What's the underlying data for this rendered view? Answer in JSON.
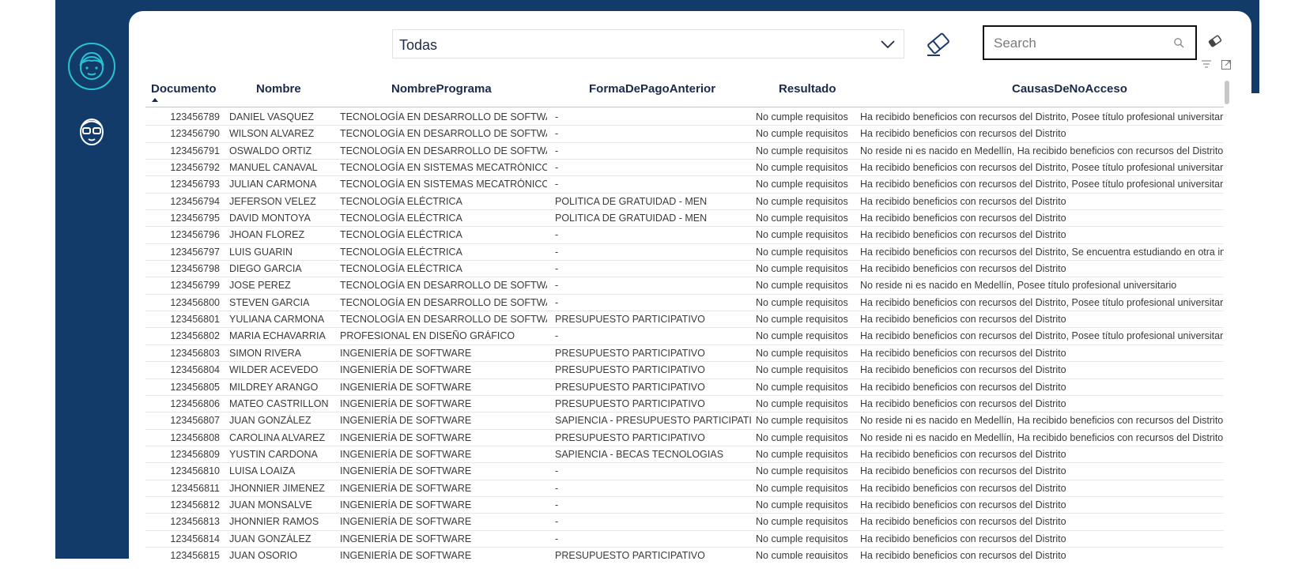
{
  "filters": {
    "dropdown_value": "Todas",
    "search_placeholder": "Search"
  },
  "table": {
    "headers": {
      "documento": "Documento",
      "nombre": "Nombre",
      "programa": "NombrePrograma",
      "pago": "FormaDePagoAnterior",
      "resultado": "Resultado",
      "causas": "CausasDeNoAcceso"
    },
    "sort": {
      "column": "Documento",
      "direction": "ascending"
    },
    "rows": [
      {
        "doc": "123456789",
        "name": "DANIEL VASQUEZ",
        "prog": "TECNOLOGÍA EN DESARROLLO DE SOFTWARE",
        "pago": "-",
        "res": "No cumple requisitos",
        "causa": "Ha recibido beneficios con recursos del Distrito, Posee título profesional universitario"
      },
      {
        "doc": "123456790",
        "name": "WILSON ALVAREZ",
        "prog": "TECNOLOGÍA EN DESARROLLO DE SOFTWARE",
        "pago": "-",
        "res": "No cumple requisitos",
        "causa": "Ha recibido beneficios con recursos del Distrito"
      },
      {
        "doc": "123456791",
        "name": "OSWALDO ORTIZ",
        "prog": "TECNOLOGÍA EN DESARROLLO DE SOFTWARE",
        "pago": "-",
        "res": "No cumple requisitos",
        "causa": "No reside ni es nacido en Medellín, Ha recibido beneficios con recursos del Distrito"
      },
      {
        "doc": "123456792",
        "name": "MANUEL CANAVAL",
        "prog": "TECNOLOGÍA EN SISTEMAS MECATRÓNICOS",
        "pago": "-",
        "res": "No cumple requisitos",
        "causa": "Ha recibido beneficios con recursos del Distrito, Posee título profesional universitario"
      },
      {
        "doc": "123456793",
        "name": "JULIAN CARMONA",
        "prog": "TECNOLOGÍA EN SISTEMAS MECATRÓNICOS",
        "pago": "-",
        "res": "No cumple requisitos",
        "causa": "Ha recibido beneficios con recursos del Distrito, Posee título profesional universitario"
      },
      {
        "doc": "123456794",
        "name": "JEFERSON VELEZ",
        "prog": "TECNOLOGÍA ELÉCTRICA",
        "pago": "POLITICA DE GRATUIDAD - MEN",
        "res": "No cumple requisitos",
        "causa": "Ha recibido beneficios con recursos del Distrito"
      },
      {
        "doc": "123456795",
        "name": "DAVID MONTOYA",
        "prog": "TECNOLOGÍA ELÉCTRICA",
        "pago": "POLITICA DE GRATUIDAD - MEN",
        "res": "No cumple requisitos",
        "causa": "Ha recibido beneficios con recursos del Distrito"
      },
      {
        "doc": "123456796",
        "name": "JHOAN FLOREZ",
        "prog": "TECNOLOGÍA ELÉCTRICA",
        "pago": "-",
        "res": "No cumple requisitos",
        "causa": "Ha recibido beneficios con recursos del Distrito"
      },
      {
        "doc": "123456797",
        "name": "LUIS GUARIN",
        "prog": "TECNOLOGÍA ELÉCTRICA",
        "pago": "-",
        "res": "No cumple requisitos",
        "causa": "Ha recibido beneficios con recursos del Distrito, Se encuentra estudiando en otra institución"
      },
      {
        "doc": "123456798",
        "name": "DIEGO GARCIA",
        "prog": "TECNOLOGÍA ELÉCTRICA",
        "pago": "-",
        "res": "No cumple requisitos",
        "causa": "Ha recibido beneficios con recursos del Distrito"
      },
      {
        "doc": "123456799",
        "name": "JOSE PEREZ",
        "prog": "TECNOLOGÍA EN DESARROLLO DE SOFTWARE",
        "pago": "-",
        "res": "No cumple requisitos",
        "causa": "No reside ni es nacido en Medellín, Posee título profesional universitario"
      },
      {
        "doc": "123456800",
        "name": "STEVEN GARCIA",
        "prog": "TECNOLOGÍA EN DESARROLLO DE SOFTWARE",
        "pago": "-",
        "res": "No cumple requisitos",
        "causa": "Ha recibido beneficios con recursos del Distrito, Posee título profesional universitario"
      },
      {
        "doc": "123456801",
        "name": "YULIANA CARMONA",
        "prog": "TECNOLOGÍA EN DESARROLLO DE SOFTWARE",
        "pago": "PRESUPUESTO PARTICIPATIVO",
        "res": "No cumple requisitos",
        "causa": "Ha recibido beneficios con recursos del Distrito"
      },
      {
        "doc": "123456802",
        "name": "MARIA ECHAVARRIA",
        "prog": "PROFESIONAL EN DISEÑO GRÁFICO",
        "pago": "-",
        "res": "No cumple requisitos",
        "causa": "Ha recibido beneficios con recursos del Distrito, Posee título profesional universitario"
      },
      {
        "doc": "123456803",
        "name": "SIMON RIVERA",
        "prog": "INGENIERÍA DE SOFTWARE",
        "pago": "PRESUPUESTO PARTICIPATIVO",
        "res": "No cumple requisitos",
        "causa": "Ha recibido beneficios con recursos del Distrito"
      },
      {
        "doc": "123456804",
        "name": "WILDER ACEVEDO",
        "prog": "INGENIERÍA DE SOFTWARE",
        "pago": "PRESUPUESTO PARTICIPATIVO",
        "res": "No cumple requisitos",
        "causa": "Ha recibido beneficios con recursos del Distrito"
      },
      {
        "doc": "123456805",
        "name": "MILDREY ARANGO",
        "prog": "INGENIERÍA DE SOFTWARE",
        "pago": "PRESUPUESTO PARTICIPATIVO",
        "res": "No cumple requisitos",
        "causa": "Ha recibido beneficios con recursos del Distrito"
      },
      {
        "doc": "123456806",
        "name": "MATEO CASTRILLON",
        "prog": "INGENIERÍA DE SOFTWARE",
        "pago": "PRESUPUESTO PARTICIPATIVO",
        "res": "No cumple requisitos",
        "causa": "Ha recibido beneficios con recursos del Distrito"
      },
      {
        "doc": "123456807",
        "name": "JUAN GONZÁLEZ",
        "prog": "INGENIERÍA DE SOFTWARE",
        "pago": "SAPIENCIA - PRESUPUESTO PARTICIPATIVO",
        "res": "No cumple requisitos",
        "causa": "No reside ni es nacido en Medellín, Ha recibido beneficios con recursos del Distrito"
      },
      {
        "doc": "123456808",
        "name": "CAROLINA ALVAREZ",
        "prog": "INGENIERÍA DE SOFTWARE",
        "pago": "PRESUPUESTO PARTICIPATIVO",
        "res": "No cumple requisitos",
        "causa": "No reside ni es nacido en Medellín, Ha recibido beneficios con recursos del Distrito"
      },
      {
        "doc": "123456809",
        "name": "YUSTIN CARDONA",
        "prog": "INGENIERÍA DE SOFTWARE",
        "pago": "SAPIENCIA - BECAS TECNOLOGIAS",
        "res": "No cumple requisitos",
        "causa": "Ha recibido beneficios con recursos del Distrito"
      },
      {
        "doc": "123456810",
        "name": "LUISA LOAIZA",
        "prog": "INGENIERÍA DE SOFTWARE",
        "pago": "-",
        "res": "No cumple requisitos",
        "causa": "Ha recibido beneficios con recursos del Distrito"
      },
      {
        "doc": "123456811",
        "name": "JHONNIER JIMENEZ",
        "prog": "INGENIERÍA DE SOFTWARE",
        "pago": "-",
        "res": "No cumple requisitos",
        "causa": "Ha recibido beneficios con recursos del Distrito"
      },
      {
        "doc": "123456812",
        "name": "JUAN MONSALVE",
        "prog": "INGENIERÍA DE SOFTWARE",
        "pago": "-",
        "res": "No cumple requisitos",
        "causa": "Ha recibido beneficios con recursos del Distrito"
      },
      {
        "doc": "123456813",
        "name": "JHONNIER RAMOS",
        "prog": "INGENIERÍA DE SOFTWARE",
        "pago": "-",
        "res": "No cumple requisitos",
        "causa": "Ha recibido beneficios con recursos del Distrito"
      },
      {
        "doc": "123456814",
        "name": "JUAN GONZÁLEZ",
        "prog": "INGENIERÍA DE SOFTWARE",
        "pago": "-",
        "res": "No cumple requisitos",
        "causa": "Ha recibido beneficios con recursos del Distrito"
      },
      {
        "doc": "123456815",
        "name": "JUAN OSORIO",
        "prog": "INGENIERÍA DE SOFTWARE",
        "pago": "PRESUPUESTO PARTICIPATIVO",
        "res": "No cumple requisitos",
        "causa": "Ha recibido beneficios con recursos del Distrito"
      }
    ]
  },
  "icons": {
    "nav_primary": "face-avatar-icon",
    "nav_secondary": "glasses-avatar-icon",
    "clear_filters": "eraser-icon",
    "search": "search-icon"
  },
  "colors": {
    "navy": "#123b6a",
    "accent": "#27c3d3"
  }
}
